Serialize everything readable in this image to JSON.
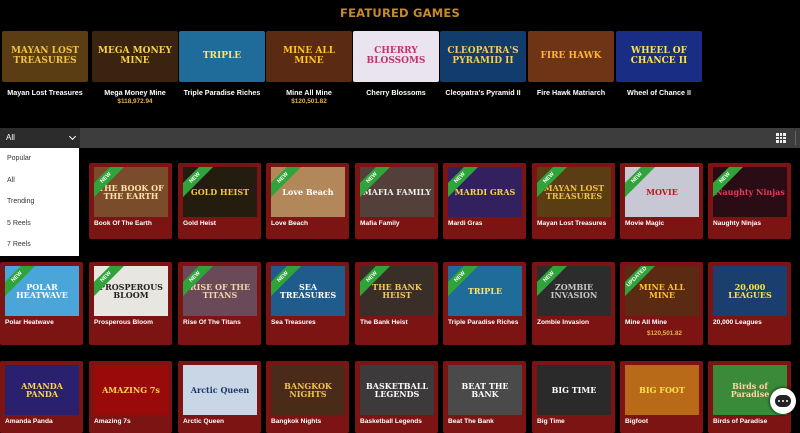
{
  "featured": {
    "title": "FEATURED GAMES",
    "games": [
      {
        "name": "Mayan Lost Treasures",
        "art": "MAYAN LOST TREASURES",
        "jackpot": "",
        "bg": "#5a3d12",
        "fg": "#f1c04a"
      },
      {
        "name": "Mega Money Mine",
        "art": "MEGA MONEY MINE",
        "jackpot": "$118,972.94",
        "bg": "#3a2410",
        "fg": "#f5d04a"
      },
      {
        "name": "Triple Paradise Riches",
        "art": "TRIPLE",
        "jackpot": "",
        "bg": "#1f6c9a",
        "fg": "#ffe36a"
      },
      {
        "name": "Mine All Mine",
        "art": "MINE ALL MINE",
        "jackpot": "$120,501.82",
        "bg": "#5b2a12",
        "fg": "#ffc32a"
      },
      {
        "name": "Cherry Blossoms",
        "art": "CHERRY BLOSSOMS",
        "jackpot": "",
        "bg": "#e9e4ee",
        "fg": "#c2326c"
      },
      {
        "name": "Cleopatra's Pyramid II",
        "art": "CLEOPATRA'S PYRAMID II",
        "jackpot": "",
        "bg": "#123c6b",
        "fg": "#f3cc5a"
      },
      {
        "name": "Fire Hawk Matriarch",
        "art": "FIRE HAWK",
        "jackpot": "",
        "bg": "#6d3415",
        "fg": "#ffb53a"
      },
      {
        "name": "Wheel of Chance II",
        "art": "WHEEL OF CHANCE II",
        "jackpot": "",
        "bg": "#1a2d84",
        "fg": "#ffe24a"
      }
    ]
  },
  "filter": {
    "selected": "All",
    "options": [
      "Popular",
      "All",
      "Trending",
      "5 Reels",
      "7 Reels"
    ]
  },
  "grid": {
    "rows": [
      [
        {
          "name": "",
          "art": "",
          "ribbon": "",
          "jackpot": "",
          "bg": "#7d1414",
          "fg": "#fff",
          "hidden": true
        },
        {
          "name": "Book Of The Earth",
          "art": "THE BOOK OF THE EARTH",
          "ribbon": "NEW",
          "jackpot": "",
          "bg": "#7a4c2c",
          "fg": "#ffe2a8"
        },
        {
          "name": "Gold Heist",
          "art": "GOLD HEIST",
          "ribbon": "NEW",
          "jackpot": "",
          "bg": "#251c10",
          "fg": "#f4c44a"
        },
        {
          "name": "Love Beach",
          "art": "Love Beach",
          "ribbon": "NEW",
          "jackpot": "",
          "bg": "#b2885a",
          "fg": "#ffffff"
        },
        {
          "name": "Mafia Family",
          "art": "MAFIA FAMILY",
          "ribbon": "NEW",
          "jackpot": "",
          "bg": "#54403a",
          "fg": "#eeeeee"
        },
        {
          "name": "Mardi Gras",
          "art": "MARDI GRAS",
          "ribbon": "NEW",
          "jackpot": "",
          "bg": "#33205e",
          "fg": "#f6d44a"
        },
        {
          "name": "Mayan Lost Treasures",
          "art": "MAYAN LOST TREASURES",
          "ribbon": "NEW",
          "jackpot": "",
          "bg": "#5a3d12",
          "fg": "#f1c04a"
        },
        {
          "name": "Movie Magic",
          "art": "MOVIE",
          "ribbon": "NEW",
          "jackpot": "",
          "bg": "#c8c8d4",
          "fg": "#b81818"
        },
        {
          "name": "Naughty Ninjas",
          "art": "Naughty Ninjas",
          "ribbon": "NEW",
          "jackpot": "",
          "bg": "#2a0d14",
          "fg": "#e23a5c"
        }
      ],
      [
        {
          "name": "Polar Heatwave",
          "art": "POLAR HEATWAVE",
          "ribbon": "NEW",
          "jackpot": "",
          "bg": "#4aa6d8",
          "fg": "#ffffff"
        },
        {
          "name": "Prosperous Bloom",
          "art": "PROSPEROUS BLOOM",
          "ribbon": "NEW",
          "jackpot": "",
          "bg": "#e8e6e0",
          "fg": "#222222"
        },
        {
          "name": "Rise Of The Titans",
          "art": "RISE OF THE TITANS",
          "ribbon": "NEW",
          "jackpot": "",
          "bg": "#6a4a58",
          "fg": "#f0d6aa"
        },
        {
          "name": "Sea Treasures",
          "art": "SEA TREASURES",
          "ribbon": "NEW",
          "jackpot": "",
          "bg": "#1f5c8c",
          "fg": "#ffffff"
        },
        {
          "name": "The Bank Heist",
          "art": "THE BANK HEIST",
          "ribbon": "NEW",
          "jackpot": "",
          "bg": "#3a2f28",
          "fg": "#f2c65a"
        },
        {
          "name": "Triple Paradise Riches",
          "art": "TRIPLE",
          "ribbon": "NEW",
          "jackpot": "",
          "bg": "#1f6c9a",
          "fg": "#ffe36a"
        },
        {
          "name": "Zombie Invasion",
          "art": "ZOMBIE INVASION",
          "ribbon": "NEW",
          "jackpot": "",
          "bg": "#2c2c2c",
          "fg": "#c8c8c8"
        },
        {
          "name": "Mine All Mine",
          "art": "MINE ALL MINE",
          "ribbon": "UPDATED",
          "jackpot": "$120,501.82",
          "bg": "#5b2a12",
          "fg": "#ffc32a"
        },
        {
          "name": "20,000 Leagues",
          "art": "20,000 LEAGUES",
          "ribbon": "",
          "jackpot": "",
          "bg": "#1a3f6e",
          "fg": "#ffe24a"
        }
      ],
      [
        {
          "name": "Amanda Panda",
          "art": "AMANDA PANDA",
          "ribbon": "",
          "jackpot": "",
          "bg": "#2a2070",
          "fg": "#ffd84a"
        },
        {
          "name": "Amazing 7s",
          "art": "AMAZING 7s",
          "ribbon": "",
          "jackpot": "",
          "bg": "#9a0a0a",
          "fg": "#ffd84a"
        },
        {
          "name": "Arctic Queen",
          "art": "Arctic Queen",
          "ribbon": "",
          "jackpot": "",
          "bg": "#c8d6e6",
          "fg": "#1a3a6a"
        },
        {
          "name": "Bangkok Nights",
          "art": "BANGKOK NIGHTS",
          "ribbon": "",
          "jackpot": "",
          "bg": "#4a2a18",
          "fg": "#f4c44a"
        },
        {
          "name": "Basketball Legends",
          "art": "BASKETBALL LEGENDS",
          "ribbon": "",
          "jackpot": "",
          "bg": "#3c3a3a",
          "fg": "#ffffff"
        },
        {
          "name": "Beat The Bank",
          "art": "BEAT THE BANK",
          "ribbon": "",
          "jackpot": "",
          "bg": "#4a4a4a",
          "fg": "#ffffff"
        },
        {
          "name": "Big Time",
          "art": "BIG TIME",
          "ribbon": "",
          "jackpot": "",
          "bg": "#2a2a2a",
          "fg": "#ffffff"
        },
        {
          "name": "Bigfoot",
          "art": "BIG FOOT",
          "ribbon": "",
          "jackpot": "",
          "bg": "#b86a18",
          "fg": "#ffe24a"
        },
        {
          "name": "Birds of Paradise",
          "art": "Birds of Paradise",
          "ribbon": "",
          "jackpot": "",
          "bg": "#3a8a3a",
          "fg": "#ffd8a8"
        }
      ]
    ]
  },
  "chat": {
    "icon": "chat-bubble-icon"
  }
}
